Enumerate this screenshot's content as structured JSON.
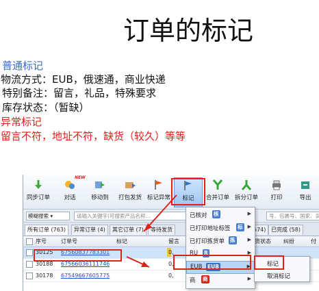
{
  "title": "订单的标记",
  "notes": {
    "normal_heading": "普通标记",
    "shipping": "物流方式：EUB，俄速通，商业快递",
    "remarks": "特别备注：留言，礼品，特殊要求",
    "stock": "库存状态：（暂缺）",
    "abnormal_heading": "异常标记",
    "abnormal_items": "留言不符，地址不符，缺货（较久）等等"
  },
  "colors": {
    "accent_blue": "#3b6fc4",
    "alert_red": "#e0201a",
    "link_blue": "#1c56c4"
  },
  "toolbar": {
    "new_badge": "NEW",
    "buttons": [
      {
        "label": "同步订单",
        "icon": "sync-icon"
      },
      {
        "label": "对话",
        "icon": "chat-icon"
      },
      {
        "label": "移动到",
        "icon": "move-icon"
      },
      {
        "label": "打包发货",
        "icon": "package-icon"
      },
      {
        "label": "标记异常",
        "icon": "flag-icon"
      },
      {
        "label": "标记",
        "icon": "mark-flag-icon"
      },
      {
        "label": "合并订单",
        "icon": "merge-icon"
      },
      {
        "label": "拆分订单",
        "icon": "split-icon"
      },
      {
        "label": "打印",
        "icon": "printer-icon"
      },
      {
        "label": "导出",
        "icon": "export-icon"
      }
    ]
  },
  "search": {
    "mode": "模糊搜索",
    "placeholder": "请输入关键字(可搜索产品名称...",
    "right_placeholder": "号、包裹号、国家、买家"
  },
  "tabs": [
    {
      "label": "所有订单 (763)"
    },
    {
      "label": "异常订单 (4)"
    },
    {
      "label": "其它订单 (7)"
    },
    {
      "label": "等待发货"
    },
    {
      "label": "574)"
    },
    {
      "label": "已完成 (58)"
    }
  ],
  "grid": {
    "headers": {
      "seq": "序号",
      "order_no": "订单号",
      "mark": "标记",
      "remain": "留言",
      "stock_status": "货状态",
      "dispute": "纠纷",
      "pay": "付"
    },
    "rows": [
      {
        "seq": "30125",
        "order_no": "67560837783301",
        "col": "0,"
      },
      {
        "seq": "30188",
        "order_no": "67566036111746",
        "col": "0,"
      },
      {
        "seq": "30178",
        "order_no": "67549667605775",
        "col": "0,"
      }
    ]
  },
  "menu": {
    "items": [
      {
        "label": "已核对",
        "badge": "核",
        "badge_color": "#4a7fd0"
      },
      {
        "label": "已打印地址标签",
        "badge": "标",
        "badge_color": "#4a7fd0"
      },
      {
        "label": "已打印拣货单",
        "badge": "拣",
        "badge_color": "#4a7fd0"
      },
      {
        "label": "RU",
        "badge": "R",
        "badge_color": "#4a7fd0"
      },
      {
        "label": "EUB",
        "badge": "EUB",
        "badge_color": "#3a6fc8"
      },
      {
        "label": "商",
        "badge": "商",
        "badge_color": "#e0201a"
      }
    ],
    "submenu": [
      "标记",
      "取消标记"
    ]
  }
}
